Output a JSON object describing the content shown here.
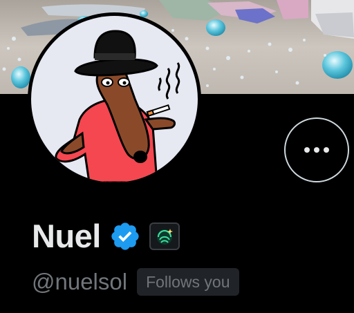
{
  "profile": {
    "display_name": "Nuel",
    "handle": "@nuelsol",
    "follows_you_label": "Follows you"
  },
  "icons": {
    "more": "more-options-icon",
    "verified": "verified-badge-icon",
    "affiliate": "affiliate-badge-icon"
  },
  "colors": {
    "background": "#000000",
    "name_text": "#e7e9ea",
    "secondary_text": "#71767b",
    "verified_blue": "#1d9bf0",
    "follows_badge_bg": "#202327",
    "button_border": "#cfd9de"
  }
}
